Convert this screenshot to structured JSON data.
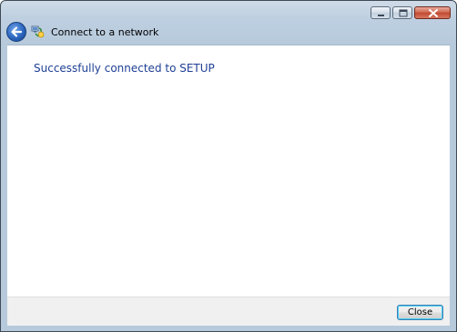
{
  "window": {
    "title": "Connect to a network",
    "controls": [
      "minimize",
      "maximize",
      "close"
    ]
  },
  "nav": {
    "back_icon": "back-arrow-icon",
    "network_icon": "network-connect-icon",
    "title": "Connect to a network"
  },
  "main": {
    "message": "Successfully connected to SETUP"
  },
  "footer": {
    "close_label": "Close"
  },
  "colors": {
    "message_text": "#1e3f94",
    "chrome": "#b7cadc",
    "close_control": "#c0492f"
  }
}
